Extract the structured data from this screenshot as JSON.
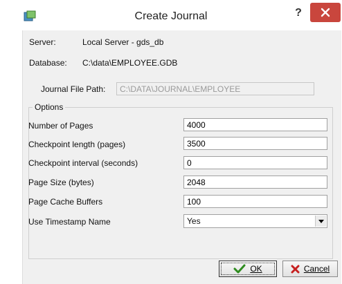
{
  "window": {
    "title": "Create Journal",
    "help_label": "?"
  },
  "info": {
    "server_label": "Server:",
    "server_value": "Local Server - gds_db",
    "database_label": "Database:",
    "database_value": "C:\\data\\EMPLOYEE.GDB"
  },
  "journal_path": {
    "label": "Journal File Path:",
    "value": "C:\\DATA\\JOURNAL\\EMPLOYEE"
  },
  "options": {
    "title": "Options",
    "fields": [
      {
        "label": "Number of Pages",
        "value": "4000"
      },
      {
        "label": "Checkpoint length (pages)",
        "value": "3500"
      },
      {
        "label": "Checkpoint interval (seconds)",
        "value": "0"
      },
      {
        "label": "Page Size (bytes)",
        "value": "2048"
      },
      {
        "label": "Page Cache Buffers",
        "value": "100"
      }
    ],
    "timestamp_label": "Use Timestamp Name",
    "timestamp_value": "Yes"
  },
  "buttons": {
    "ok_label": "OK",
    "cancel_label": "Cancel"
  },
  "colors": {
    "close_button": "#c9463d",
    "ok_check": "#2e8b1f",
    "cancel_x": "#c62020"
  }
}
